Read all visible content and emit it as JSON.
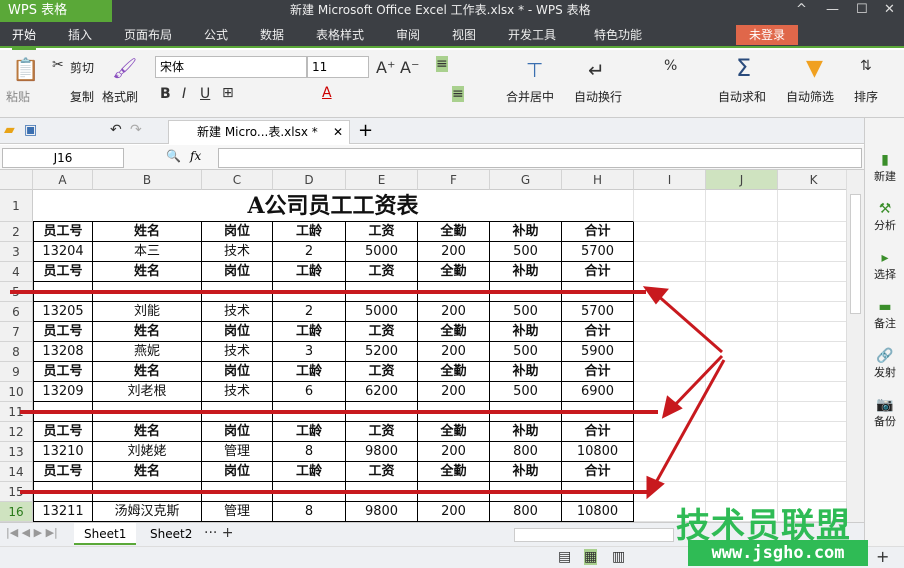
{
  "app": {
    "logo": "WPS 表格",
    "title": "新建 Microsoft Office Excel 工作表.xlsx * - WPS 表格",
    "login": "未登录"
  },
  "menu": [
    "开始",
    "插入",
    "页面布局",
    "公式",
    "数据",
    "表格样式",
    "审阅",
    "视图",
    "开发工具",
    "特色功能"
  ],
  "ribbon": {
    "paste": "粘贴",
    "cut": "剪切",
    "copy": "复制",
    "format_painter": "格式刷",
    "font": "宋体",
    "size": "11",
    "merge": "合并居中",
    "wrap": "自动换行",
    "autosum": "自动求和",
    "filter": "自动筛选",
    "sort": "排序"
  },
  "doc_tab": "新建 Micro...表.xlsx *",
  "name_box": "J16",
  "fx": "fx",
  "columns": [
    "A",
    "B",
    "C",
    "D",
    "E",
    "F",
    "G",
    "H",
    "I",
    "J",
    "K"
  ],
  "sheet": {
    "title": "A公司员工工资表",
    "rows": [
      {
        "n": "2",
        "type": "h",
        "cells": [
          "员工号",
          "姓名",
          "岗位",
          "工龄",
          "工资",
          "全勤",
          "补助",
          "合计"
        ]
      },
      {
        "n": "3",
        "type": "d",
        "cells": [
          "13204",
          "本三",
          "技术",
          "2",
          "5000",
          "200",
          "500",
          "5700"
        ]
      },
      {
        "n": "4",
        "type": "h",
        "cells": [
          "员工号",
          "姓名",
          "岗位",
          "工龄",
          "工资",
          "全勤",
          "补助",
          "合计"
        ]
      },
      {
        "n": "5",
        "type": "e",
        "cells": [
          "",
          "",
          "",
          "",
          "",
          "",
          "",
          ""
        ]
      },
      {
        "n": "6",
        "type": "d",
        "cells": [
          "13205",
          "刘能",
          "技术",
          "2",
          "5000",
          "200",
          "500",
          "5700"
        ]
      },
      {
        "n": "7",
        "type": "h",
        "cells": [
          "员工号",
          "姓名",
          "岗位",
          "工龄",
          "工资",
          "全勤",
          "补助",
          "合计"
        ]
      },
      {
        "n": "8",
        "type": "d",
        "cells": [
          "13208",
          "燕妮",
          "技术",
          "3",
          "5200",
          "200",
          "500",
          "5900"
        ]
      },
      {
        "n": "9",
        "type": "h",
        "cells": [
          "员工号",
          "姓名",
          "岗位",
          "工龄",
          "工资",
          "全勤",
          "补助",
          "合计"
        ]
      },
      {
        "n": "10",
        "type": "d",
        "cells": [
          "13209",
          "刘老根",
          "技术",
          "6",
          "6200",
          "200",
          "500",
          "6900"
        ]
      },
      {
        "n": "11",
        "type": "e",
        "cells": [
          "",
          "",
          "",
          "",
          "",
          "",
          "",
          ""
        ]
      },
      {
        "n": "12",
        "type": "h",
        "cells": [
          "员工号",
          "姓名",
          "岗位",
          "工龄",
          "工资",
          "全勤",
          "补助",
          "合计"
        ]
      },
      {
        "n": "13",
        "type": "d",
        "cells": [
          "13210",
          "刘姥姥",
          "管理",
          "8",
          "9800",
          "200",
          "800",
          "10800"
        ]
      },
      {
        "n": "14",
        "type": "h",
        "cells": [
          "员工号",
          "姓名",
          "岗位",
          "工龄",
          "工资",
          "全勤",
          "补助",
          "合计"
        ]
      },
      {
        "n": "15",
        "type": "e",
        "cells": [
          "",
          "",
          "",
          "",
          "",
          "",
          "",
          ""
        ]
      },
      {
        "n": "16",
        "type": "d",
        "cells": [
          "13211",
          "汤姆汉克斯",
          "管理",
          "8",
          "9800",
          "200",
          "800",
          "10800"
        ]
      }
    ]
  },
  "side_panel": [
    "新建",
    "分析",
    "选择",
    "备注",
    "发射",
    "备份"
  ],
  "sheets": [
    "Sheet1",
    "Sheet2"
  ],
  "watermark": {
    "text": "技术员联盟",
    "url": "www.jsgho.com"
  },
  "colors": {
    "accent": "#5aa838",
    "annotation": "#c8191e"
  }
}
